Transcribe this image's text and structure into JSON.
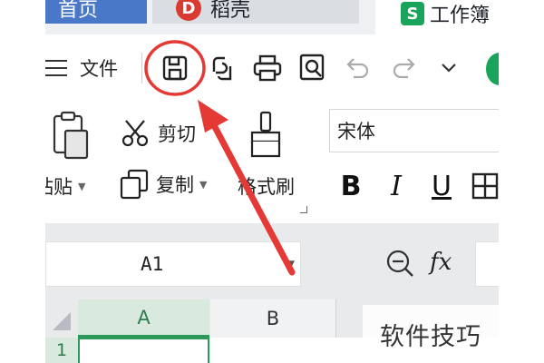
{
  "tabs": [
    {
      "label": "首页"
    },
    {
      "label": "稻壳",
      "icon": "docer-icon"
    },
    {
      "label": "工作簿",
      "icon": "spreadsheet-icon"
    }
  ],
  "logos": {
    "docer_glyph": "D",
    "sheet_glyph": "S"
  },
  "quick_access": {
    "menu_label": "文件",
    "icons": [
      "save-icon",
      "export-share-icon",
      "print-icon",
      "print-preview-icon",
      "undo-icon",
      "redo-icon",
      "customize-dropdown-icon"
    ]
  },
  "ribbon": {
    "paste_label": "粘贴",
    "cut_label": "剪切",
    "copy_label": "复制",
    "format_painter_label": "格式刷",
    "font_name": "宋体",
    "bold_label": "B",
    "italic_label": "I",
    "underline_label": "U"
  },
  "formula_bar": {
    "cell_reference": "A1",
    "fx_label": "fx"
  },
  "grid": {
    "columns": [
      "A",
      "B"
    ],
    "rows": [
      "1"
    ]
  },
  "annotation": {
    "highlight": "save-icon",
    "color": "#e53935"
  },
  "watermark": "软件技巧",
  "colors": {
    "home_tab": "#4a78c8",
    "selection_green": "#2d9a5c",
    "docer_red": "#d93b30"
  }
}
